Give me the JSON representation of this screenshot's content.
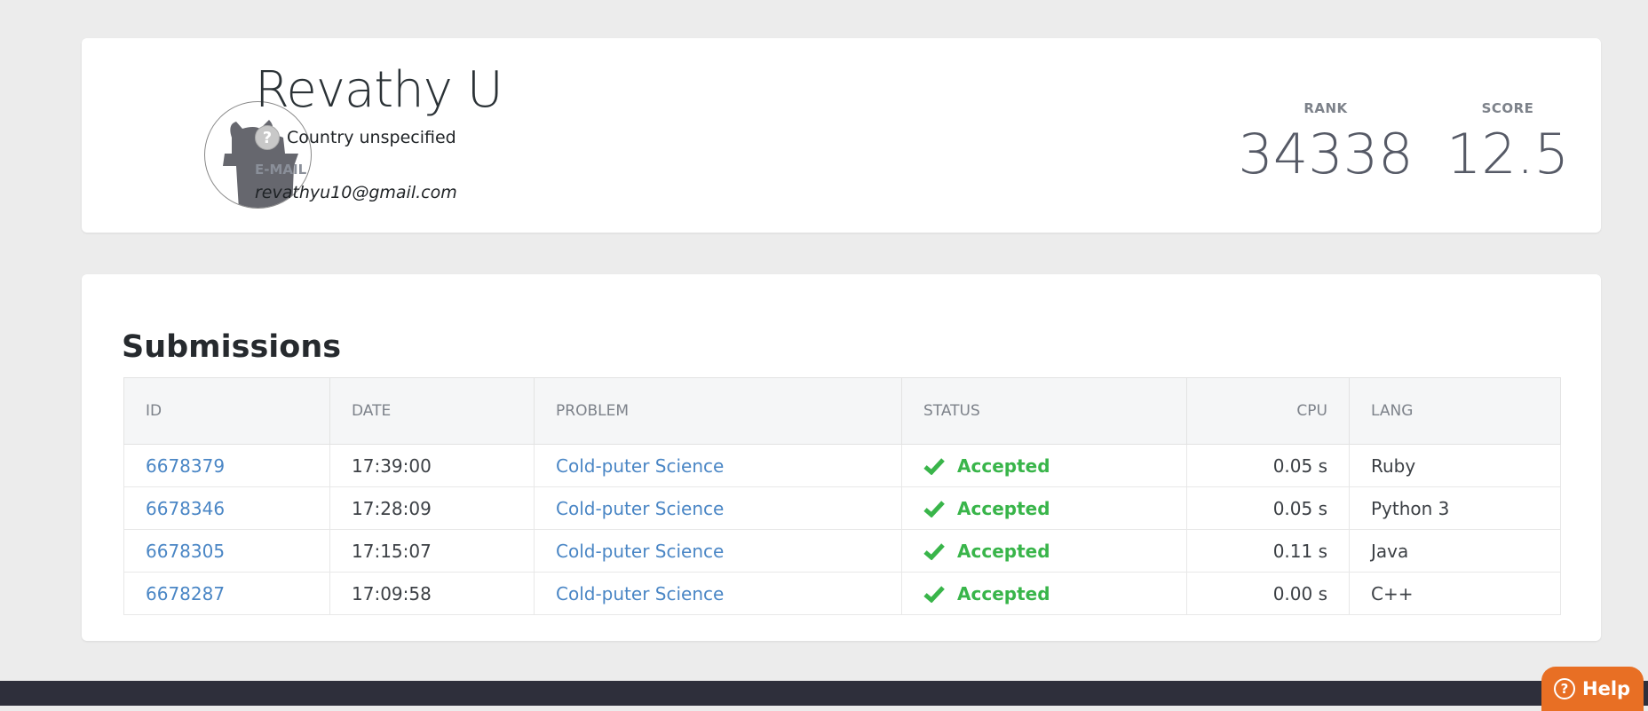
{
  "profile": {
    "name": "Revathy U",
    "country": "Country unspecified",
    "email_label": "E-MAIL",
    "email": "revathyu10@gmail.com",
    "rank_label": "RANK",
    "rank": "34338",
    "score_label": "SCORE",
    "score": "12.5"
  },
  "submissions": {
    "title": "Submissions",
    "columns": [
      "ID",
      "DATE",
      "PROBLEM",
      "STATUS",
      "CPU",
      "LANG"
    ],
    "rows": [
      {
        "id": "6678379",
        "date": "17:39:00",
        "problem": "Cold-puter Science",
        "status": "Accepted",
        "cpu": "0.05 s",
        "lang": "Ruby"
      },
      {
        "id": "6678346",
        "date": "17:28:09",
        "problem": "Cold-puter Science",
        "status": "Accepted",
        "cpu": "0.05 s",
        "lang": "Python 3"
      },
      {
        "id": "6678305",
        "date": "17:15:07",
        "problem": "Cold-puter Science",
        "status": "Accepted",
        "cpu": "0.11 s",
        "lang": "Java"
      },
      {
        "id": "6678287",
        "date": "17:09:58",
        "problem": "Cold-puter Science",
        "status": "Accepted",
        "cpu": "0.00 s",
        "lang": "C++"
      }
    ]
  },
  "help": {
    "label": "Help"
  },
  "colors": {
    "link": "#4a86c5",
    "accepted": "#39b54a",
    "help": "#e86f24",
    "footer": "#2e2f3b"
  }
}
